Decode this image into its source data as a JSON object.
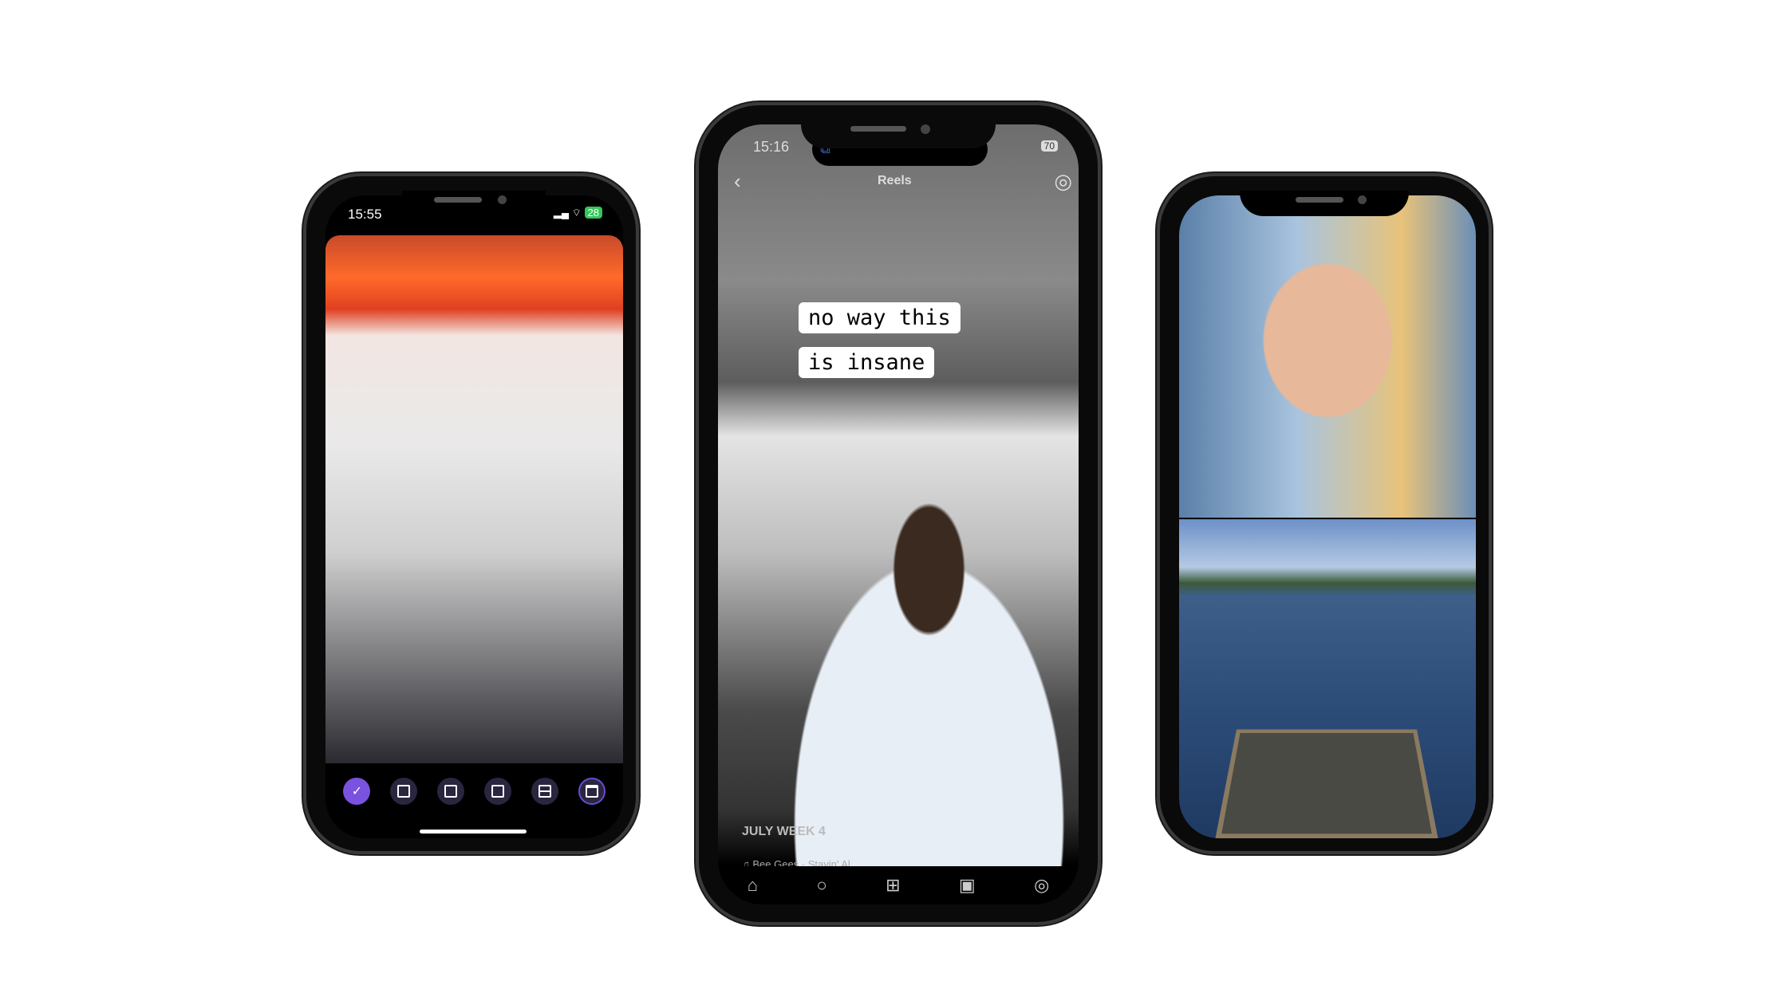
{
  "left_phone": {
    "status": {
      "time": "15:55",
      "battery": "28"
    },
    "toolbar": [
      {
        "icon": "check-icon",
        "glyph": "✓",
        "active": true
      },
      {
        "icon": "small-frame-icon"
      },
      {
        "icon": "portrait-icon"
      },
      {
        "icon": "corner-frame-icon"
      },
      {
        "icon": "split-horizontal-icon"
      },
      {
        "icon": "window-layout-icon",
        "selected": true
      }
    ],
    "accent": "#7a52e0"
  },
  "center_phone": {
    "status": {
      "time": "15:16",
      "battery": "70"
    },
    "header": {
      "title": "Reels"
    },
    "captions": [
      "no way this",
      "is insane"
    ],
    "reel_title": "JULY WEEK 4",
    "audio": "Bee Gees · Stayin' Al",
    "nav": [
      {
        "icon": "home-icon",
        "glyph": "⌂"
      },
      {
        "icon": "search-icon",
        "glyph": "○"
      },
      {
        "icon": "add-icon",
        "glyph": "⊞"
      },
      {
        "icon": "reels-icon",
        "glyph": "▣"
      },
      {
        "icon": "profile-icon",
        "glyph": "◎"
      }
    ]
  },
  "right_phone": {}
}
